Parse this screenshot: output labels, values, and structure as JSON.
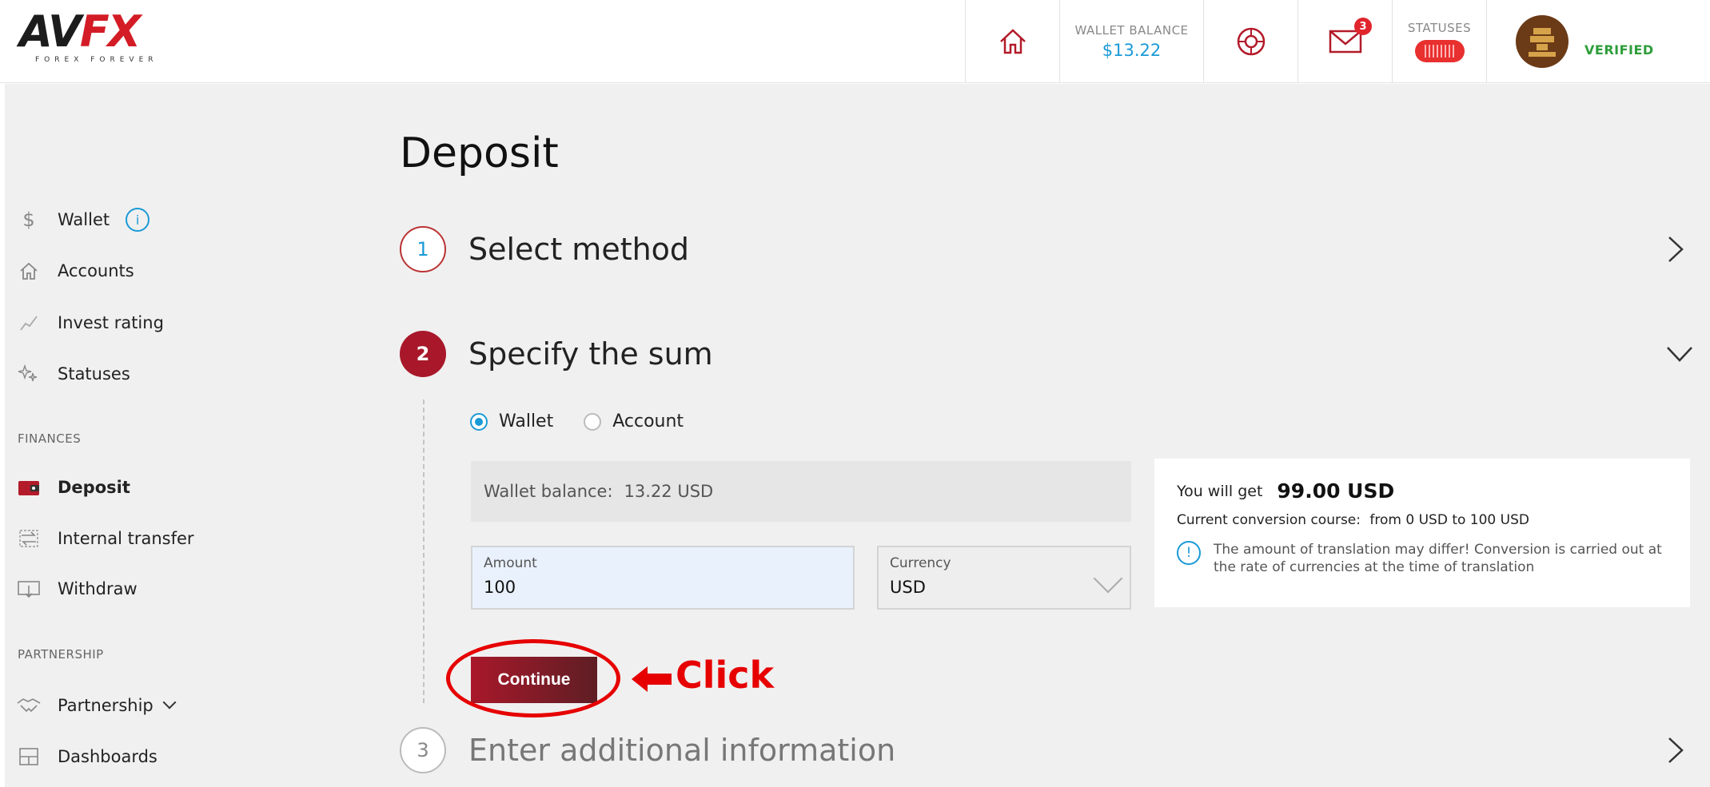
{
  "header": {
    "logo": {
      "main_left": "AV",
      "main_right": "FX",
      "tagline": "FOREX FOREVER"
    },
    "wallet_balance_label": "WALLET BALANCE",
    "wallet_balance_value": "$13.22",
    "messages_count": "3",
    "statuses_label": "STATUSES",
    "verified_label": "VERIFIED"
  },
  "sidebar": {
    "items": [
      {
        "label": "Wallet",
        "icon": "dollar-icon"
      },
      {
        "label": "Accounts",
        "icon": "home-icon"
      },
      {
        "label": "Invest rating",
        "icon": "chart-line-icon"
      },
      {
        "label": "Statuses",
        "icon": "stars-icon"
      }
    ],
    "finances_heading": "FINANCES",
    "finances": [
      {
        "label": "Deposit",
        "icon": "wallet-icon"
      },
      {
        "label": "Internal transfer",
        "icon": "transfer-icon"
      },
      {
        "label": "Withdraw",
        "icon": "withdraw-icon"
      }
    ],
    "partnership_heading": "PARTNERSHIP",
    "partnership": [
      {
        "label": "Partnership",
        "icon": "handshake-icon"
      },
      {
        "label": "Dashboards",
        "icon": "dashboard-icon"
      }
    ]
  },
  "page_title": "Deposit",
  "steps": [
    {
      "number": "1",
      "title": "Select method"
    },
    {
      "number": "2",
      "title": "Specify the sum"
    },
    {
      "number": "3",
      "title": "Enter additional information"
    }
  ],
  "form": {
    "radio_wallet": "Wallet",
    "radio_account": "Account",
    "wallet_balance_label": "Wallet balance:",
    "wallet_balance_value": "13.22 USD",
    "amount_label": "Amount",
    "amount_value": "100",
    "currency_label": "Currency",
    "currency_value": "USD",
    "continue_label": "Continue"
  },
  "annotation": {
    "click_text": "Click",
    "color": "#e60000"
  },
  "summary": {
    "you_get_label": "You will get",
    "you_get_value": "99.00 USD",
    "conversion_label": "Current conversion course:",
    "conversion_value": "from 0 USD to 100 USD",
    "note": "The amount of translation may differ! Conversion is carried out at the rate of currencies at the time of translation"
  },
  "colors": {
    "accent": "#a8182a",
    "link": "#1a9ad6",
    "verified": "#2e9d3a",
    "badge": "#e0252d"
  }
}
